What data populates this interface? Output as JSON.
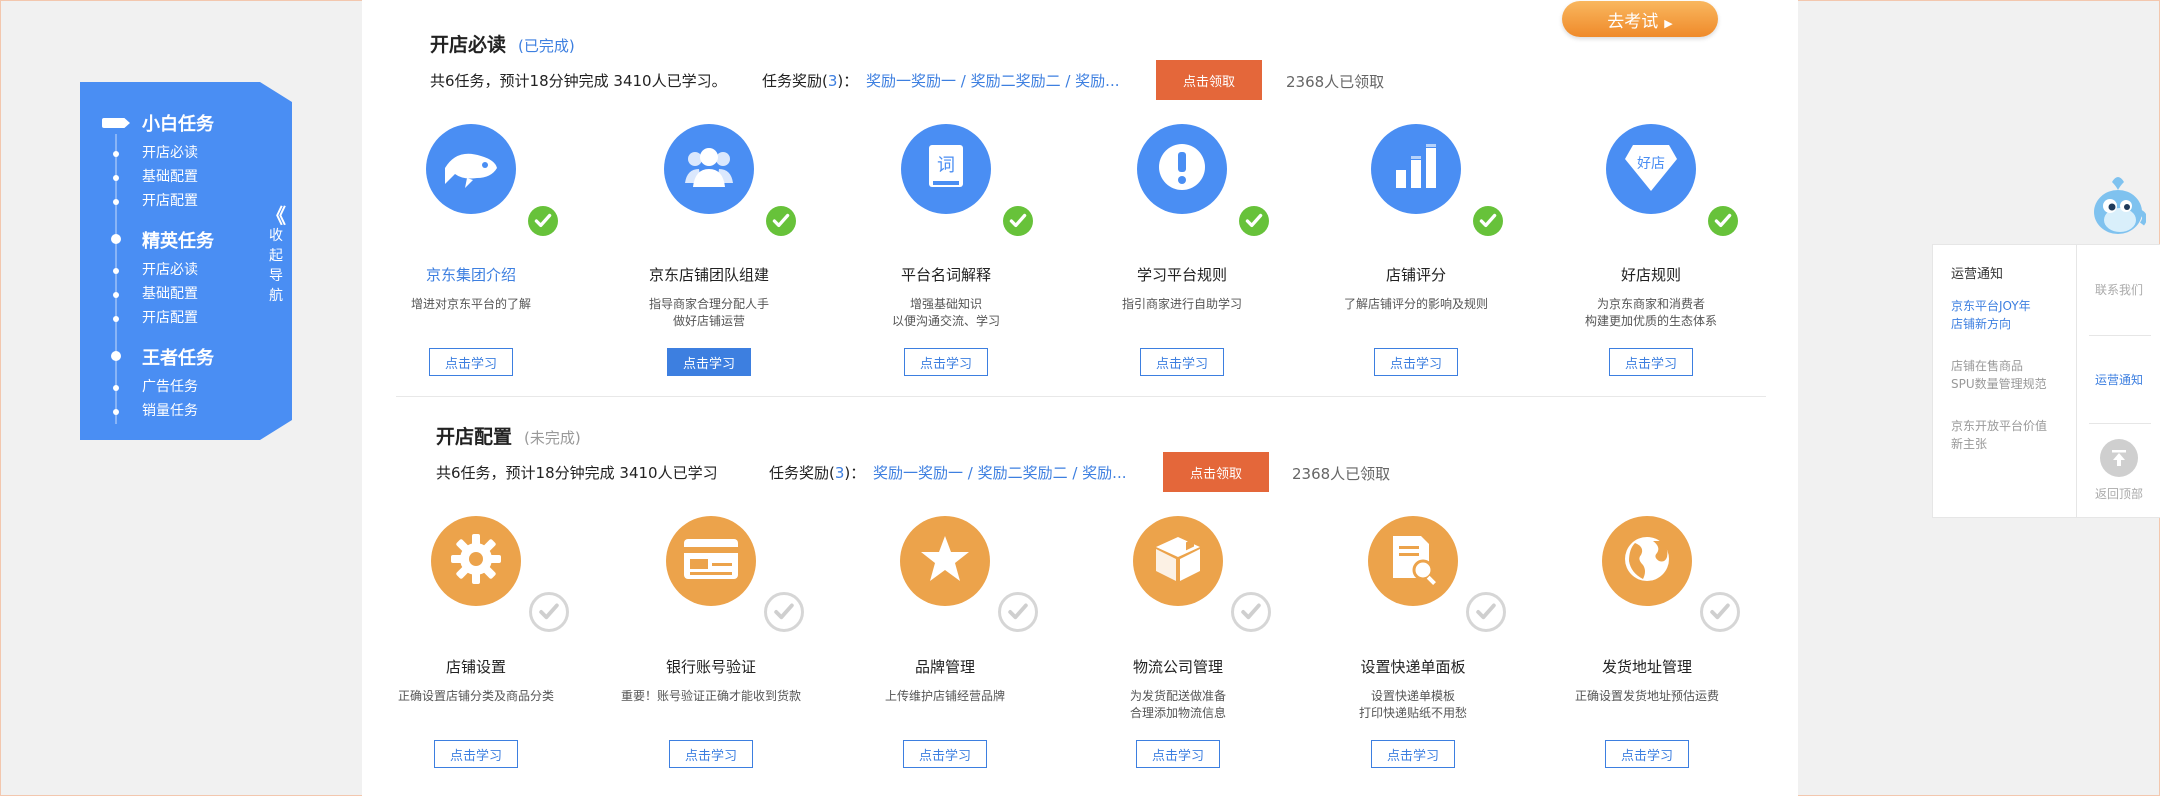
{
  "nav": {
    "groups": [
      {
        "title": "小白任务",
        "items": [
          "开店必读",
          "基础配置",
          "开店配置"
        ]
      },
      {
        "title": "精英任务",
        "items": [
          "开店必读",
          "基础配置",
          "开店配置"
        ]
      },
      {
        "title": "王者任务",
        "items": [
          "广告任务",
          "销量任务"
        ]
      }
    ],
    "collapse": {
      "chevron": "《",
      "chars": [
        "收",
        "起",
        "导",
        "航"
      ]
    }
  },
  "exam_button": {
    "label": "去考试",
    "arrow": "▶"
  },
  "section1": {
    "title": "开店必读",
    "status": "(已完成)",
    "info": "共6任务，预计18分钟完成 3410人已学习。",
    "reward_label_pre": "任务奖励(",
    "reward_count": "3",
    "reward_label_post": ")：",
    "reward_text": "奖励一奖励一 / 奖励二奖励二 / 奖励...",
    "claim_label": "点击领取",
    "claimed_text": "2368人已领取",
    "tasks": [
      {
        "name": "京东集团介绍",
        "desc": [
          "增进对京东平台的了解"
        ],
        "button": "点击学习",
        "icon": "fish-icon",
        "status": "done"
      },
      {
        "name": "京东店铺团队组建",
        "desc": [
          "指导商家合理分配人手",
          "做好店铺运营"
        ],
        "button": "点击学习",
        "icon": "team-icon",
        "status": "done"
      },
      {
        "name": "平台名词解释",
        "desc": [
          "增强基础知识",
          "以便沟通交流、学习"
        ],
        "button": "点击学习",
        "icon": "dictionary-icon",
        "icon_text": "词",
        "status": "done"
      },
      {
        "name": "学习平台规则",
        "desc": [
          "指引商家进行自助学习"
        ],
        "button": "点击学习",
        "icon": "exclamation-icon",
        "status": "done"
      },
      {
        "name": "店铺评分",
        "desc": [
          "了解店铺评分的影响及规则"
        ],
        "button": "点击学习",
        "icon": "bar-chart-icon",
        "status": "done"
      },
      {
        "name": "好店规则",
        "desc": [
          "为京东商家和消费者",
          "构建更加优质的生态体系"
        ],
        "button": "点击学习",
        "icon": "diamond-icon",
        "icon_text": "好店",
        "status": "done"
      }
    ]
  },
  "section2": {
    "title": "开店配置",
    "status": "(未完成)",
    "info": "共6任务，预计18分钟完成 3410人已学习",
    "reward_label_pre": "任务奖励(",
    "reward_count": "3",
    "reward_label_post": ")：",
    "reward_text": "奖励一奖励一 / 奖励二奖励二 / 奖励...",
    "claim_label": "点击领取",
    "claimed_text": "2368人已领取",
    "tasks": [
      {
        "name": "店铺设置",
        "desc": [
          "正确设置店铺分类及商品分类"
        ],
        "button": "点击学习",
        "icon": "gear-icon",
        "status": "pending"
      },
      {
        "name": "银行账号验证",
        "desc": [
          "重要！账号验证正确才能收到货款"
        ],
        "button": "点击学习",
        "icon": "bank-card-icon",
        "status": "pending"
      },
      {
        "name": "品牌管理",
        "desc": [
          "上传维护店铺经营品牌"
        ],
        "button": "点击学习",
        "icon": "star-icon",
        "status": "pending"
      },
      {
        "name": "物流公司管理",
        "desc": [
          "为发货配送做准备",
          "合理添加物流信息"
        ],
        "button": "点击学习",
        "icon": "box-icon",
        "status": "pending"
      },
      {
        "name": "设置快递单面板",
        "desc": [
          "设置快递单模板",
          "打印快递贴纸不用愁"
        ],
        "button": "点击学习",
        "icon": "document-search-icon",
        "status": "pending"
      },
      {
        "name": "发货地址管理",
        "desc": [
          "正确设置发货地址预估运费"
        ],
        "button": "点击学习",
        "icon": "globe-icon",
        "status": "pending"
      }
    ]
  },
  "right_panel": {
    "title": "运营通知",
    "items": [
      {
        "text": [
          "京东平台JOY年",
          "店铺新方向"
        ],
        "active": true
      },
      {
        "text": [
          "店铺在售商品",
          "SPU数量管理规范"
        ],
        "active": false
      },
      {
        "text": [
          "京东开放平台价值",
          "新主张"
        ],
        "active": false
      }
    ],
    "tabs": [
      "联系我们",
      "运营通知",
      "返回顶部"
    ]
  },
  "colors": {
    "accent": "#4a8ef3",
    "link": "#3d7fe0",
    "claim": "#e4673a",
    "orange": "#eca34b",
    "check": "#67c23a"
  }
}
